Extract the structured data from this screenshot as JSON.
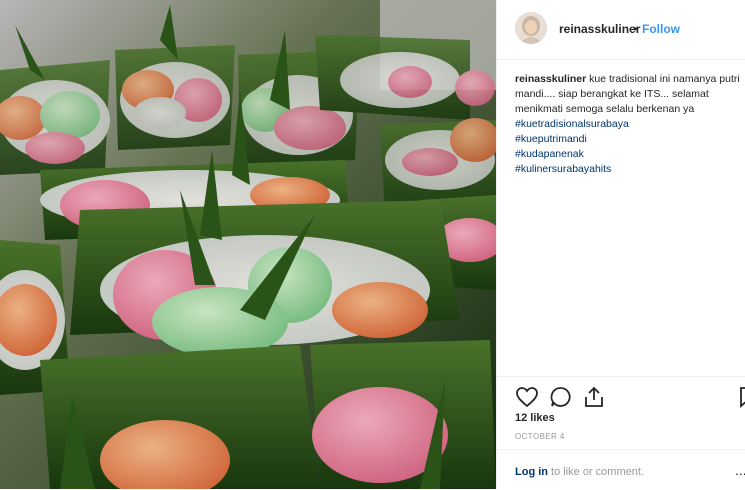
{
  "post": {
    "username": "reinasskuliner",
    "separator": "•",
    "follow_label": "Follow",
    "caption_username": "reinasskuliner",
    "caption_text": "kue tradisional ini namanya putri mandi.... siap berangkat ke ITS... selamat menikmati semoga selalu berkenan ya",
    "hashtags": [
      "#kuetradisionalsurabaya",
      "#kueputrimandi",
      "#kudapanenak",
      "#kulinersurabayahits"
    ],
    "likes": "12 likes",
    "date": "OCTOBER 4",
    "login_link": "Log in",
    "login_text": " to like or comment.",
    "more": "..."
  },
  "icons": {
    "like": "heart-icon",
    "comment": "comment-icon",
    "share": "share-icon",
    "save": "bookmark-icon"
  },
  "colors": {
    "link": "#3897f0",
    "hashtag": "#003569",
    "muted": "#999999"
  }
}
